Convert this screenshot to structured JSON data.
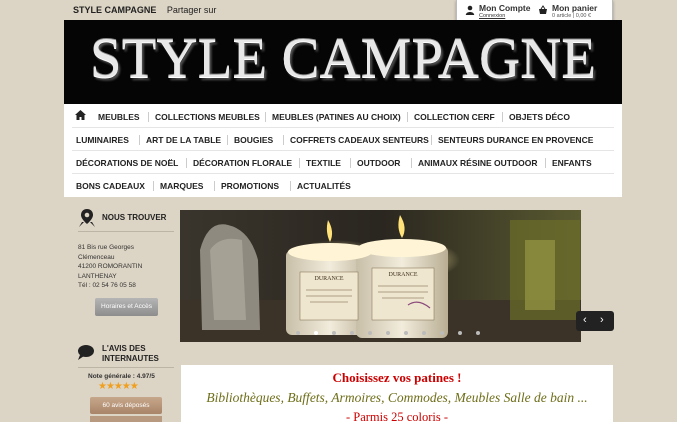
{
  "topbar": {
    "brand": "STYLE CAMPAGNE",
    "share": "Partager sur"
  },
  "account": {
    "title": "Mon Compte",
    "link": "Connexion"
  },
  "cart": {
    "title": "Mon panier",
    "summary": "0 article | 0,00 €"
  },
  "banner": {
    "logo_text": "STYLE CAMPAGNE"
  },
  "menu": {
    "row1": [
      "MEUBLES",
      "COLLECTIONS MEUBLES",
      "MEUBLES (PATINES AU CHOIX)",
      "COLLECTION CERF",
      "OBJETS DÉCO"
    ],
    "row2": [
      "LUMINAIRES",
      "ART DE LA TABLE",
      "BOUGIES",
      "COFFRETS CADEAUX SENTEURS",
      "SENTEURS DURANCE EN PROVENCE"
    ],
    "row3": [
      "DÉCORATIONS DE NOËL",
      "DÉCORATION FLORALE",
      "TEXTILE",
      "OUTDOOR",
      "ANIMAUX RÉSINE OUTDOOR",
      "ENFANTS"
    ],
    "row4": [
      "BONS CADEAUX",
      "MARQUES",
      "PROMOTIONS",
      "ACTUALITÉS"
    ]
  },
  "find_us": {
    "heading": "NOUS TROUVER",
    "address": [
      "81 Bis rue Georges",
      "Clémenceau",
      "41200 ROMORANTIN",
      "LANTHENAY",
      "Tél : 02 54 76 05 58"
    ],
    "button": "Horaires et Accès"
  },
  "reviews": {
    "heading_1": "L'AVIS DES",
    "heading_2": "INTERNAUTES",
    "rating": "Note générale : 4.97/5",
    "stars": "★★★★★",
    "button": "60 avis déposés"
  },
  "slider": {
    "candle_label_1": "DURANCE",
    "candle_label_2": "DURANCE"
  },
  "promo": {
    "line1": "Choisissez vos patines !",
    "line2": "Bibliothèques, Buffets, Armoires, Commodes, Meubles Salle de bain ...",
    "line3": "- Parmis 25 coloris -"
  },
  "colors": {
    "background": "#dcd4c4",
    "banner": "#050505",
    "promo_red": "#cc0000",
    "promo_olive": "#6e6e1a"
  }
}
